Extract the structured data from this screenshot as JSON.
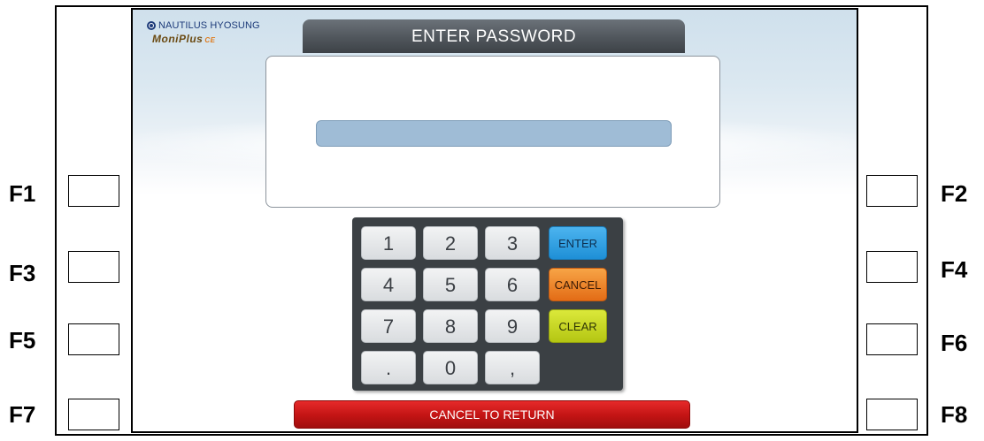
{
  "logo": {
    "brand": "NAUTILUS HYOSUNG",
    "product": "MoniPlus",
    "product_suffix": "CE"
  },
  "title": "ENTER PASSWORD",
  "password_field": {
    "value": ""
  },
  "keypad": {
    "keys": [
      "1",
      "2",
      "3",
      "4",
      "5",
      "6",
      "7",
      "8",
      "9",
      ".",
      "0",
      ","
    ],
    "enter_label": "ENTER",
    "cancel_label": "CANCEL",
    "clear_label": "CLEAR"
  },
  "cancel_to_return": "CANCEL TO RETURN",
  "function_keys": {
    "f1": "F1",
    "f2": "F2",
    "f3": "F3",
    "f4": "F4",
    "f5": "F5",
    "f6": "F6",
    "f7": "F7",
    "f8": "F8"
  },
  "colors": {
    "enter": "#1e8fd6",
    "cancel": "#e36c16",
    "clear": "#b4c613",
    "cancel_to_return": "#c21414",
    "title_bar": "#50565c",
    "password_field": "#9fbcd6"
  }
}
